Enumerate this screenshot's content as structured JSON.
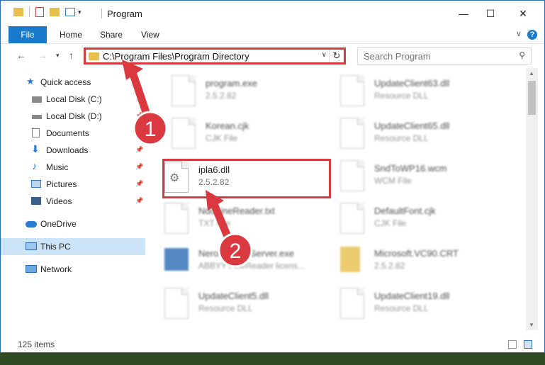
{
  "window": {
    "title": "Program"
  },
  "titlebar": {
    "minimize": "—",
    "maximize": "☐",
    "close": "✕"
  },
  "ribbon": {
    "tabs": [
      {
        "label": "File"
      },
      {
        "label": "Home"
      },
      {
        "label": "Share"
      },
      {
        "label": "View"
      }
    ]
  },
  "address": {
    "path": "C:\\Program Files\\Program Directory"
  },
  "search": {
    "placeholder": "Search Program"
  },
  "sidebar": {
    "items": [
      {
        "label": "Quick access"
      },
      {
        "label": "Local Disk (C:)"
      },
      {
        "label": "Local Disk (D:)"
      },
      {
        "label": "Documents"
      },
      {
        "label": "Downloads"
      },
      {
        "label": "Music"
      },
      {
        "label": "Pictures"
      },
      {
        "label": "Videos"
      },
      {
        "label": "OneDrive"
      },
      {
        "label": "This PC"
      },
      {
        "label": "Network"
      }
    ]
  },
  "files": [
    {
      "name": "program.exe",
      "sub": "2.5.2.82"
    },
    {
      "name": "UpdateClient63.dll",
      "sub": "Resource DLL"
    },
    {
      "name": "Korean.cjk",
      "sub": "CJK File"
    },
    {
      "name": "UpdateClient65.dll",
      "sub": "Resource DLL"
    },
    {
      "name": "ipla6.dll",
      "sub": "2.5.2.82"
    },
    {
      "name": "SndToWP16.wcm",
      "sub": "WCM File"
    },
    {
      "name": "NdonineReader.txt",
      "sub": "TXT File"
    },
    {
      "name": "DefaultFont.cjk",
      "sub": "CJK File"
    },
    {
      "name": "NeroLicenseServer.exe",
      "sub": "ABBYY FineReader licens..."
    },
    {
      "name": "Microsoft.VC90.CRT",
      "sub": "2.5.2.82"
    },
    {
      "name": "UpdateClient5.dll",
      "sub": "Resource DLL"
    },
    {
      "name": "UpdateClient19.dll",
      "sub": "Resource DLL"
    }
  ],
  "status": {
    "count": "125 items"
  },
  "annotations": {
    "step1": "1",
    "step2": "2",
    "color": "#d9393f"
  }
}
